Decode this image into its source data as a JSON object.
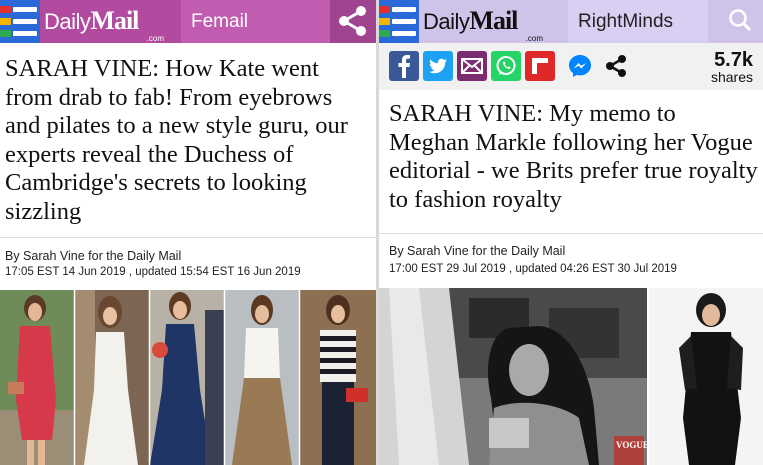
{
  "left": {
    "logo": {
      "daily": "Daily",
      "mail": "Mail",
      "com": ".com"
    },
    "section": "Femail",
    "headline": "SARAH VINE: How Kate went from drab to fab! From eyebrows and pilates to a new style guru, our experts reveal the Duchess of Cambridge's secrets to looking sizzling",
    "byline": "By Sarah Vine for the Daily Mail",
    "dateline": "17:05 EST 14 Jun 2019 , updated 15:54 EST 16 Jun 2019"
  },
  "right": {
    "logo": {
      "daily": "Daily",
      "mail": "Mail",
      "com": ".com"
    },
    "section": "RightMinds",
    "shares_count": "5.7k",
    "shares_label": "shares",
    "headline": "SARAH VINE: My memo to Meghan Markle following her Vogue editorial - we Brits prefer true royalty to fashion royalty",
    "byline": "By Sarah Vine for the Daily Mail",
    "dateline": "17:00 EST 29 Jul 2019 , updated 04:26 EST 30 Jul 2019",
    "magazine_text": "VOGUE"
  },
  "icons": [
    "menu-icon",
    "share-icon",
    "search-icon",
    "facebook-icon",
    "twitter-icon",
    "email-icon",
    "whatsapp-icon",
    "flipboard-icon",
    "messenger-icon",
    "share-icon"
  ],
  "colors": {
    "femail_header": "#b24aa0",
    "rightminds_header": "#cfc3ea",
    "menu_blue": "#2a6ad8",
    "facebook": "#3b5998",
    "twitter": "#1da1f2",
    "email": "#7b2d6f",
    "whatsapp": "#25d366",
    "flipboard": "#e12828",
    "messenger": "#0084ff"
  }
}
